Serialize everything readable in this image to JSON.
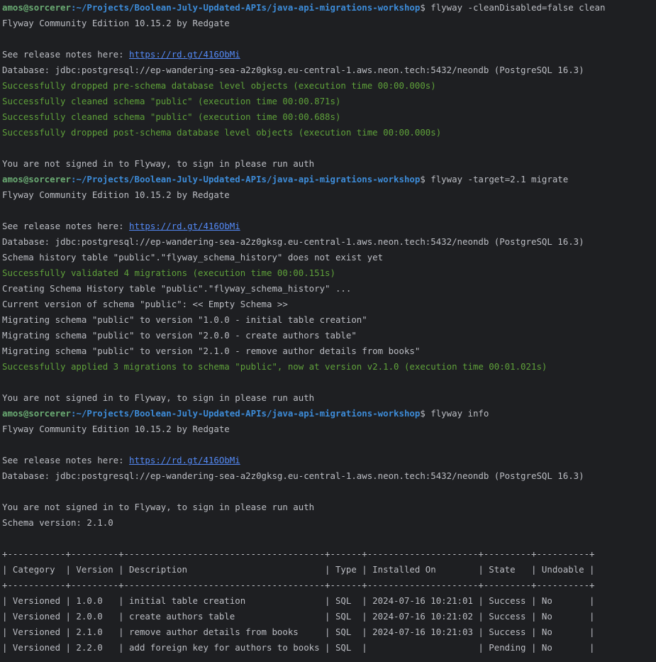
{
  "colors": {
    "background": "#1e1f22",
    "text": "#bcbec4",
    "success": "#5fa13a",
    "link": "#548af7",
    "prompt_user": "#6aab73",
    "prompt_path": "#3d8cd9"
  },
  "prompt": {
    "user": "amos@sorcerer",
    "path": ":~/Projects/Boolean-July-Updated-APIs/java-api-migrations-workshop",
    "symbol": "$ "
  },
  "lines": [
    {
      "type": "prompt",
      "command": "flyway -cleanDisabled=false clean"
    },
    {
      "type": "text",
      "text": "Flyway Community Edition 10.15.2 by Redgate"
    },
    {
      "type": "blank"
    },
    {
      "type": "link",
      "text": "See release notes here: ",
      "link": "https://rd.gt/416ObMi"
    },
    {
      "type": "text",
      "text": "Database: jdbc:postgresql://ep-wandering-sea-a2z0gksg.eu-central-1.aws.neon.tech:5432/neondb (PostgreSQL 16.3)"
    },
    {
      "type": "success",
      "text": "Successfully dropped pre-schema database level objects (execution time 00:00.000s)"
    },
    {
      "type": "success",
      "text": "Successfully cleaned schema \"public\" (execution time 00:00.871s)"
    },
    {
      "type": "success",
      "text": "Successfully cleaned schema \"public\" (execution time 00:00.688s)"
    },
    {
      "type": "success",
      "text": "Successfully dropped post-schema database level objects (execution time 00:00.000s)"
    },
    {
      "type": "blank"
    },
    {
      "type": "text",
      "text": "You are not signed in to Flyway, to sign in please run auth"
    },
    {
      "type": "prompt",
      "command": "flyway -target=2.1 migrate"
    },
    {
      "type": "text",
      "text": "Flyway Community Edition 10.15.2 by Redgate"
    },
    {
      "type": "blank"
    },
    {
      "type": "link",
      "text": "See release notes here: ",
      "link": "https://rd.gt/416ObMi"
    },
    {
      "type": "text",
      "text": "Database: jdbc:postgresql://ep-wandering-sea-a2z0gksg.eu-central-1.aws.neon.tech:5432/neondb (PostgreSQL 16.3)"
    },
    {
      "type": "text",
      "text": "Schema history table \"public\".\"flyway_schema_history\" does not exist yet"
    },
    {
      "type": "success",
      "text": "Successfully validated 4 migrations (execution time 00:00.151s)"
    },
    {
      "type": "text",
      "text": "Creating Schema History table \"public\".\"flyway_schema_history\" ..."
    },
    {
      "type": "text",
      "text": "Current version of schema \"public\": << Empty Schema >>"
    },
    {
      "type": "text",
      "text": "Migrating schema \"public\" to version \"1.0.0 - initial table creation\""
    },
    {
      "type": "text",
      "text": "Migrating schema \"public\" to version \"2.0.0 - create authors table\""
    },
    {
      "type": "text",
      "text": "Migrating schema \"public\" to version \"2.1.0 - remove author details from books\""
    },
    {
      "type": "success",
      "text": "Successfully applied 3 migrations to schema \"public\", now at version v2.1.0 (execution time 00:01.021s)"
    },
    {
      "type": "blank"
    },
    {
      "type": "text",
      "text": "You are not signed in to Flyway, to sign in please run auth"
    },
    {
      "type": "prompt",
      "command": "flyway info"
    },
    {
      "type": "text",
      "text": "Flyway Community Edition 10.15.2 by Redgate"
    },
    {
      "type": "blank"
    },
    {
      "type": "link",
      "text": "See release notes here: ",
      "link": "https://rd.gt/416ObMi"
    },
    {
      "type": "text",
      "text": "Database: jdbc:postgresql://ep-wandering-sea-a2z0gksg.eu-central-1.aws.neon.tech:5432/neondb (PostgreSQL 16.3)"
    },
    {
      "type": "blank"
    },
    {
      "type": "text",
      "text": "You are not signed in to Flyway, to sign in please run auth"
    },
    {
      "type": "text",
      "text": "Schema version: 2.1.0"
    },
    {
      "type": "blank"
    },
    {
      "type": "text",
      "text": "+-----------+---------+--------------------------------------+------+---------------------+---------+----------+"
    },
    {
      "type": "text",
      "text": "| Category  | Version | Description                          | Type | Installed On        | State   | Undoable |"
    },
    {
      "type": "text",
      "text": "+-----------+---------+--------------------------------------+------+---------------------+---------+----------+"
    },
    {
      "type": "text",
      "text": "| Versioned | 1.0.0   | initial table creation               | SQL  | 2024-07-16 10:21:01 | Success | No       |"
    },
    {
      "type": "text",
      "text": "| Versioned | 2.0.0   | create authors table                 | SQL  | 2024-07-16 10:21:02 | Success | No       |"
    },
    {
      "type": "text",
      "text": "| Versioned | 2.1.0   | remove author details from books     | SQL  | 2024-07-16 10:21:03 | Success | No       |"
    },
    {
      "type": "text",
      "text": "| Versioned | 2.2.0   | add foreign key for authors to books | SQL  |                     | Pending | No       |"
    }
  ]
}
